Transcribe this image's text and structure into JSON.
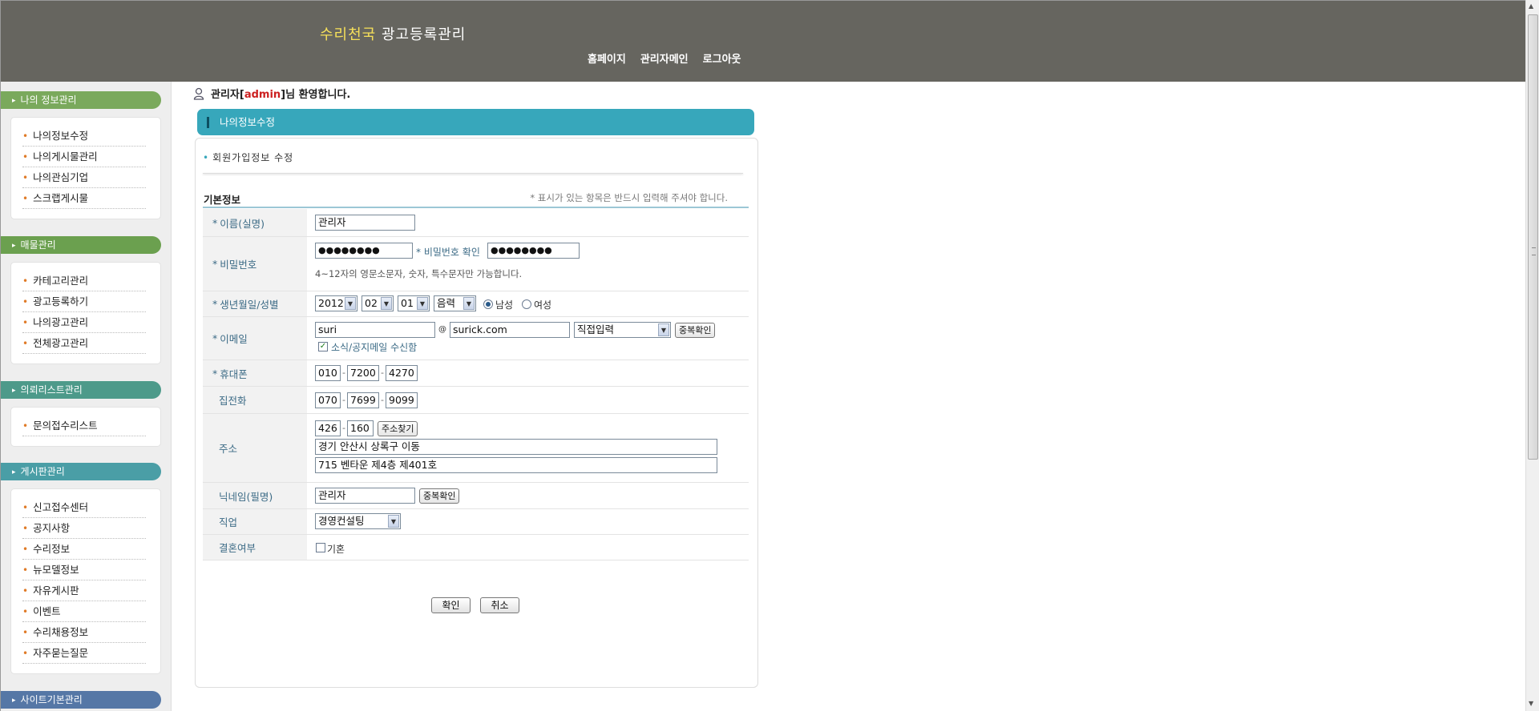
{
  "header": {
    "logo_brand": "수리천국",
    "logo_text": "광고등록관리",
    "nav": [
      "홈페이지",
      "관리자메인",
      "로그아웃"
    ]
  },
  "sidebar": {
    "sections": [
      {
        "title": "나의 정보관리",
        "items": [
          "나의정보수정",
          "나의게시물관리",
          "나의관심기업",
          "스크랩게시물"
        ]
      },
      {
        "title": "매물관리",
        "items": [
          "카테고리관리",
          "광고등록하기",
          "나의광고관리",
          "전체광고관리"
        ]
      },
      {
        "title": "의뢰리스트관리",
        "items": [
          "문의접수리스트"
        ]
      },
      {
        "title": "게시판관리",
        "items": [
          "신고접수센터",
          "공지사항",
          "수리정보",
          "뉴모델정보",
          "자유게시판",
          "이벤트",
          "수리채용정보",
          "자주묻는질문"
        ]
      },
      {
        "title": "사이트기본관리",
        "items": []
      }
    ]
  },
  "welcome": {
    "prefix": "관리자[",
    "admin": "admin",
    "suffix": "]님 환영합니다."
  },
  "panel": {
    "title": "나의정보수정",
    "subtitle": "회원가입정보 수정",
    "section_label": "기본정보",
    "notice": "* 표시가 있는 항목은 반드시 입력해 주셔야 합니다."
  },
  "form": {
    "name": {
      "label": "이름(실명)",
      "value": "관리자"
    },
    "password": {
      "label": "비밀번호",
      "value": "●●●●●●●●",
      "confirm_label": "* 비밀번호 확인",
      "confirm_value": "●●●●●●●●",
      "hint": "4~12자의 영문소문자, 숫자, 특수문자만 가능합니다."
    },
    "birth": {
      "label": "생년월일/성별",
      "year": "2012",
      "month": "02",
      "day": "01",
      "calendar": "음력",
      "male": "남성",
      "female": "여성"
    },
    "email": {
      "label": "이메일",
      "id": "suri",
      "at": "@",
      "domain": "surick.com",
      "select": "직접입력",
      "check_btn": "중복확인",
      "subscribe": "소식/공지메일 수신함"
    },
    "mobile": {
      "label": "휴대폰",
      "p1": "010",
      "p2": "7200",
      "p3": "4270"
    },
    "home": {
      "label": "집전화",
      "p1": "070",
      "p2": "7699",
      "p3": "9099"
    },
    "address": {
      "label": "주소",
      "zip1": "426",
      "zip2": "160",
      "find_btn": "주소찾기",
      "line1": "경기 안산시 상록구 이동",
      "line2": "715 벤타운 제4층 제401호"
    },
    "nickname": {
      "label": "닉네임(필명)",
      "value": "관리자",
      "check_btn": "중복확인"
    },
    "job": {
      "label": "직업",
      "value": "경영컨설팅"
    },
    "married": {
      "label": "결혼여부",
      "option": "기혼"
    }
  },
  "buttons": {
    "confirm": "확인",
    "cancel": "취소"
  },
  "colors": {
    "header_bg": "#66655f",
    "panel_title_bg": "#37a7bb",
    "sec_green": "#7aa95c",
    "sec_teal": "#4d9a8a",
    "sec_cyan": "#4a9ea6",
    "sec_blue": "#5577a6"
  }
}
